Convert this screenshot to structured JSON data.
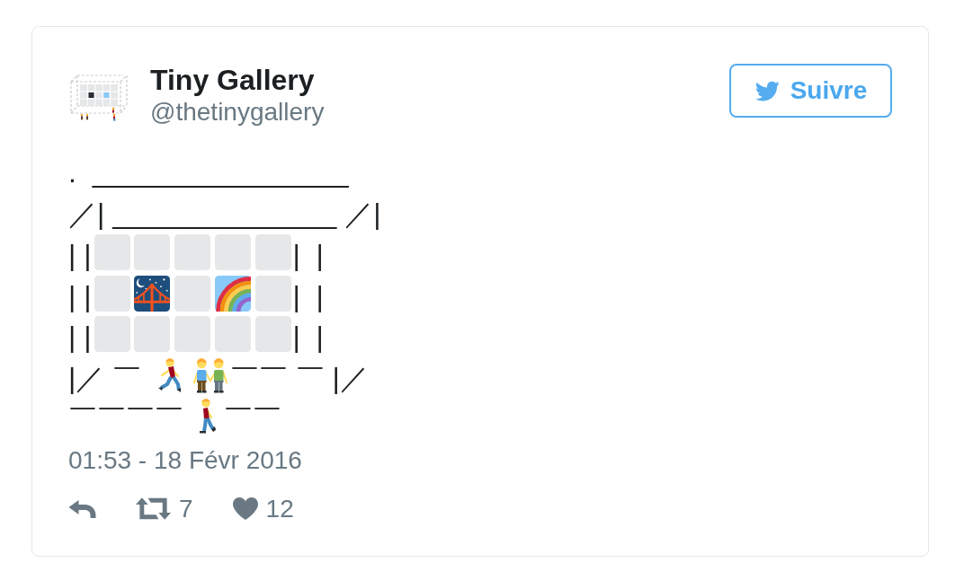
{
  "author": {
    "name": "Tiny Gallery",
    "handle": "@thetinygallery"
  },
  "follow_button": {
    "label": "Suivre"
  },
  "tweet": {
    "lines": [
      {
        "segments": [
          {
            "kind": "text",
            "text": ".  ________________"
          }
        ]
      },
      {
        "segments": [
          {
            "kind": "text",
            "text": "／| ______________ ／|"
          }
        ]
      },
      {
        "segments": [
          {
            "kind": "text",
            "text": "| |"
          },
          {
            "kind": "tile"
          },
          {
            "kind": "tile"
          },
          {
            "kind": "tile"
          },
          {
            "kind": "tile"
          },
          {
            "kind": "tile"
          },
          {
            "kind": "text",
            "text": "|  |"
          }
        ]
      },
      {
        "segments": [
          {
            "kind": "text",
            "text": "| |"
          },
          {
            "kind": "tile"
          },
          {
            "kind": "bridge"
          },
          {
            "kind": "tile"
          },
          {
            "kind": "rainbow"
          },
          {
            "kind": "tile"
          },
          {
            "kind": "text",
            "text": "|  |"
          }
        ]
      },
      {
        "segments": [
          {
            "kind": "text",
            "text": "| |"
          },
          {
            "kind": "tile"
          },
          {
            "kind": "tile"
          },
          {
            "kind": "tile"
          },
          {
            "kind": "tile"
          },
          {
            "kind": "tile"
          },
          {
            "kind": "text",
            "text": "|  |"
          }
        ]
      },
      {
        "segments": [
          {
            "kind": "text",
            "text": "|／ ￣ "
          },
          {
            "kind": "runner"
          },
          {
            "kind": "couple"
          },
          {
            "kind": "text",
            "text": "￣￣ ￣ |／"
          }
        ]
      },
      {
        "segments": [
          {
            "kind": "text",
            "text": "￣￣￣￣"
          },
          {
            "kind": "walker"
          },
          {
            "kind": "text",
            "text": "￣￣"
          }
        ]
      }
    ]
  },
  "timestamp": "01:53 - 18 Févr 2016",
  "actions": [
    {
      "kind": "reply"
    },
    {
      "kind": "retweet",
      "count": "7"
    },
    {
      "kind": "like",
      "count": "12"
    }
  ]
}
